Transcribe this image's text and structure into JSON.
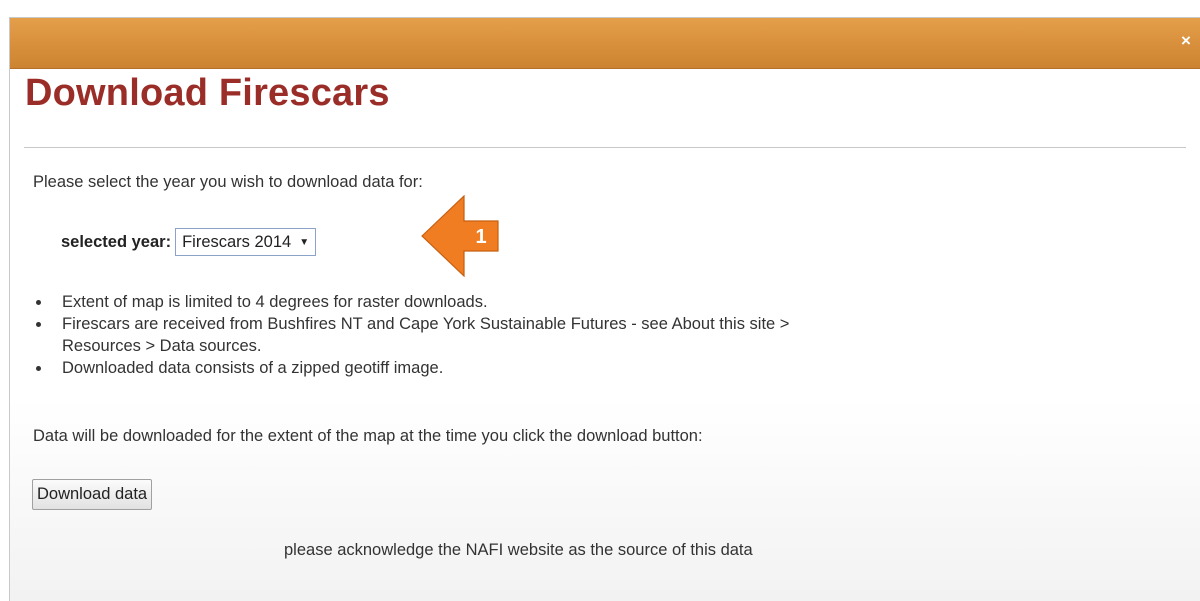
{
  "dialog": {
    "close_glyph": "×",
    "title": "Download Firescars",
    "instruction": "Please select the year you wish to download data for:",
    "year_label": "selected year:",
    "year_select": {
      "selected": "Firescars 2014",
      "caret": "▼"
    },
    "callout": {
      "number": "1",
      "color": "#f07d22"
    },
    "notes": [
      "Extent of map is limited to 4 degrees for raster downloads.",
      "Firescars are received from Bushfires NT and Cape York Sustainable Futures - see About this site >",
      "Resources > Data sources.",
      "Downloaded data consists of a zipped geotiff image."
    ],
    "extent_text": "Data will be downloaded for the extent of the map at the time you click the download button:",
    "download_button": "Download data",
    "acknowledgement": "please acknowledge the NAFI website as the source of this data"
  },
  "colors": {
    "titlebar": "#d88f3c",
    "title_text": "#9b2d28",
    "callout": "#f07d22"
  }
}
